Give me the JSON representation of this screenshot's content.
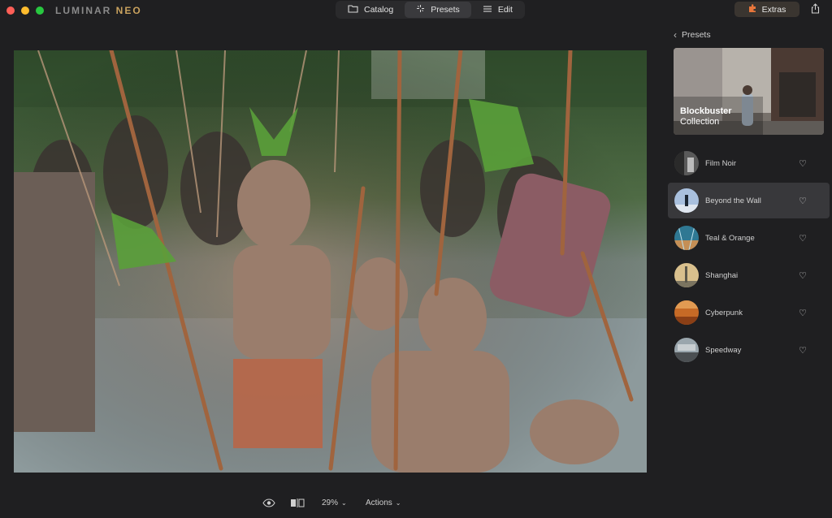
{
  "app": {
    "logo_main": "LUMINAR ",
    "logo_accent": "NEO"
  },
  "modes": [
    {
      "label": "Catalog",
      "icon": "folder-icon",
      "active": false
    },
    {
      "label": "Presets",
      "icon": "sparkle-icon",
      "active": true
    },
    {
      "label": "Edit",
      "icon": "sliders-icon",
      "active": false
    }
  ],
  "header": {
    "extras_label": "Extras",
    "extras_color": "#e8763b",
    "share_icon": "share-icon"
  },
  "toolbar": {
    "zoom_value": "29%",
    "actions_label": "Actions",
    "eye_icon": "eye-icon",
    "compare_icon": "compare-icon"
  },
  "panel": {
    "back_label": "Presets",
    "collection": {
      "title": "Blockbuster",
      "subtitle": "Collection"
    },
    "presets": [
      {
        "name": "Film Noir",
        "selected": false,
        "color": "#777777"
      },
      {
        "name": "Beyond the Wall",
        "selected": true,
        "color": "#9db5d6"
      },
      {
        "name": "Teal & Orange",
        "selected": false,
        "color": "#3f8ea6"
      },
      {
        "name": "Shanghai",
        "selected": false,
        "color": "#c8b07a"
      },
      {
        "name": "Cyberpunk",
        "selected": false,
        "color": "#c8692c"
      },
      {
        "name": "Speedway",
        "selected": false,
        "color": "#8d9aa2"
      }
    ]
  }
}
